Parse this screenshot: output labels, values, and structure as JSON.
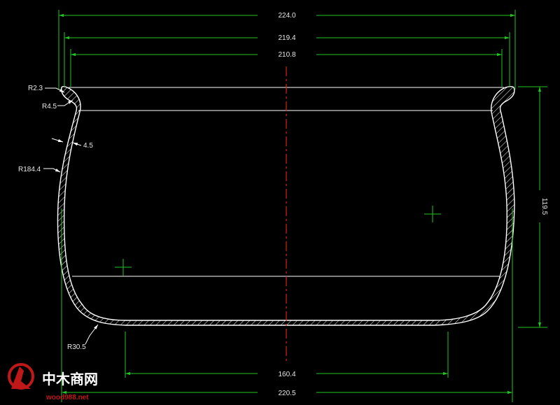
{
  "dimensions": {
    "overall_width": "224.0",
    "outer_rim_width": "219.4",
    "inner_rim_width": "210.8",
    "height": "119.5",
    "base_width": "160.4",
    "bottom_width": "220.5"
  },
  "radii": {
    "rim_outer": "R2.3",
    "rim_inner": "R4.5",
    "wall_thickness": "4.5",
    "body_radius": "R184.4",
    "bottom_radius": "R30.5"
  },
  "watermark": {
    "cn_text": "中木商网",
    "url": "wood988.net"
  },
  "colors": {
    "background": "#000000",
    "outline": "#ffffff",
    "dimension": "#22c422",
    "centerline": "#d42020",
    "text": "#e6e6e6",
    "watermark_red": "#c01818"
  }
}
